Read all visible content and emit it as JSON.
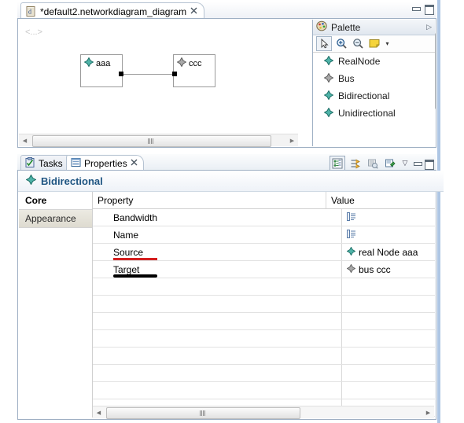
{
  "editor": {
    "tab": {
      "title": "*default2.networkdiagram_diagram",
      "icon": "diagram-file-icon",
      "close": "✖"
    },
    "window_controls": {
      "minimize": "minimize-icon",
      "maximize": "maximize-icon"
    },
    "canvas": {
      "label_top_left": "<...>",
      "nodes": [
        {
          "label": "aaa",
          "icon_color": "#2e9c92"
        },
        {
          "label": "ccc",
          "icon_color": "#8a8a8a"
        }
      ],
      "connection": {
        "from": "aaa",
        "to": "ccc",
        "style": "bidirectional"
      }
    },
    "scroll": {
      "up": "▲",
      "down": "▼",
      "left": "◀",
      "right": "▶"
    }
  },
  "palette": {
    "title": "Palette",
    "header_icon": "palette-icon",
    "collapse_arrow": "▷",
    "tools": [
      {
        "name": "select-tool",
        "glyph": "arrow"
      },
      {
        "name": "zoom-in-tool",
        "glyph": "magnifier-plus"
      },
      {
        "name": "zoom-out-tool",
        "glyph": "magnifier-minus"
      },
      {
        "name": "note-tool",
        "glyph": "note"
      },
      {
        "name": "note-dropdown",
        "glyph": "▾"
      }
    ],
    "items": [
      {
        "label": "RealNode",
        "icon_color": "#2e9c92"
      },
      {
        "label": "Bus",
        "icon_color": "#8a8a8a"
      },
      {
        "label": "Bidirectional",
        "icon_color": "#2e9c92"
      },
      {
        "label": "Unidirectional",
        "icon_color": "#2e9c92"
      }
    ]
  },
  "properties_view": {
    "tabs": [
      {
        "label": "Tasks",
        "icon": "tasks-icon",
        "active": false
      },
      {
        "label": "Properties",
        "icon": "properties-icon",
        "active": true,
        "close": "✖"
      }
    ],
    "toolbar": [
      {
        "name": "show-categories-button",
        "pressed": true
      },
      {
        "name": "sort-filter-button",
        "pressed": false
      },
      {
        "name": "restore-defaults-button",
        "pressed": false
      },
      {
        "name": "pin-properties-button",
        "pressed": false
      },
      {
        "name": "view-menu-button",
        "glyph": "▽"
      },
      {
        "name": "minimize-button",
        "glyph": "minimize-icon"
      },
      {
        "name": "maximize-button",
        "glyph": "maximize-icon"
      }
    ],
    "title": "Bidirectional",
    "title_icon_color": "#2e9c92",
    "side_tabs": [
      {
        "label": "Core",
        "selected": true
      },
      {
        "label": "Appearance",
        "selected": false
      }
    ],
    "table": {
      "columns": [
        "Property",
        "Value"
      ],
      "rows": [
        {
          "property": "Bandwidth",
          "value": "",
          "value_icon": "text-edit-icon",
          "underline": "none"
        },
        {
          "property": "Name",
          "value": "",
          "value_icon": "text-edit-icon",
          "underline": "none"
        },
        {
          "property": "Source",
          "value": "real Node aaa",
          "value_icon": "node-diamond-icon",
          "icon_color": "#2e9c92",
          "underline": "red"
        },
        {
          "property": "Target",
          "value": "bus ccc",
          "value_icon": "node-diamond-icon",
          "icon_color": "#8a8a8a",
          "underline": "black"
        }
      ],
      "empty_row_count": 8
    },
    "scroll": {
      "left": "◀",
      "right": "▶"
    }
  },
  "colors": {
    "accent_teal": "#2e9c92",
    "title_blue": "#1f5582",
    "underline_red": "#d41f1f",
    "underline_black": "#000000",
    "border": "#9fb0c4"
  }
}
